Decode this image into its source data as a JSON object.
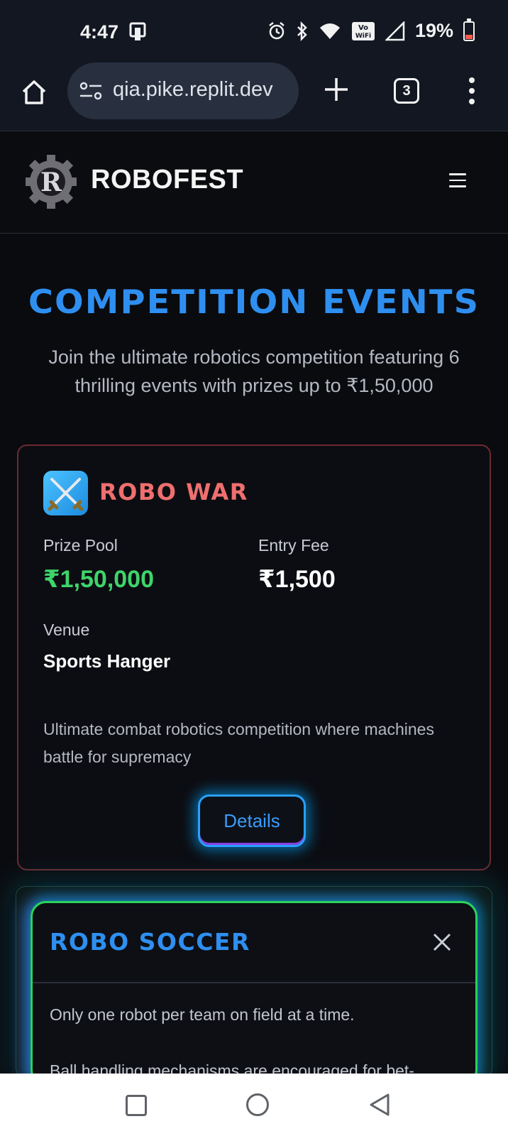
{
  "status_bar": {
    "time": "4:47",
    "battery": "19%",
    "icons": [
      "phone-icon",
      "alarm-icon",
      "bluetooth-icon",
      "wifi-icon",
      "vowifi-icon",
      "signal-icon",
      "battery-icon"
    ]
  },
  "browser": {
    "url": "qia.pike.replit.dev",
    "tab_count": "3"
  },
  "header": {
    "brand": "ROBOFEST"
  },
  "main": {
    "title": "COMPETITION EVENTS",
    "subtitle": "Join the ultimate robotics competition featuring 6 thrilling events with prizes up to ₹1,50,000"
  },
  "event": {
    "name": "ROBO WAR",
    "prize_label": "Prize Pool",
    "prize_value": "₹1,50,000",
    "fee_label": "Entry Fee",
    "fee_value": "₹1,500",
    "venue_label": "Venue",
    "venue_value": "Sports Hanger",
    "description": "Ultimate combat robotics competition where machines battle for supremacy",
    "details_label": "Details"
  },
  "modal": {
    "title": "ROBO SOCCER",
    "line1": "Only one robot per team on field at a time.",
    "line2": "Ball handling mechanisms are encouraged for bet-"
  },
  "colors": {
    "accent_blue": "#2e8ff0",
    "event_red": "#ef6f6f",
    "prize_green": "#3ed46b",
    "modal_border": "#29d35a"
  }
}
